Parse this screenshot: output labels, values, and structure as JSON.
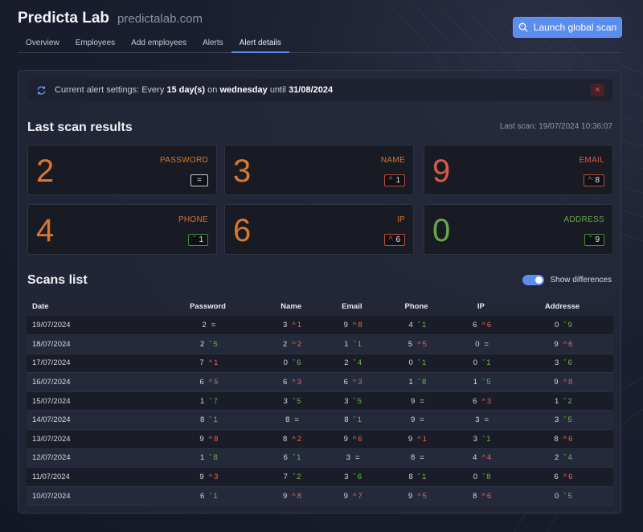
{
  "app": {
    "brand": "Predicta Lab",
    "domain": "predictalab.com"
  },
  "actions": {
    "launch_label": "Launch global scan"
  },
  "tabs": [
    "Overview",
    "Employees",
    "Add employees",
    "Alerts",
    "Alert details"
  ],
  "active_tab": "Alert details",
  "alert": {
    "prefix": "Current alert settings: Every ",
    "days": "15 day(s)",
    "mid1": " on ",
    "weekday": "wednesday",
    "mid2": " until ",
    "until": "31/08/2024",
    "close": "×"
  },
  "results": {
    "title": "Last scan results",
    "last_scan": "Last scan: 19/07/2024 10:36:07",
    "cards": [
      {
        "label": "PASSWORD",
        "value": "2",
        "color": "orange",
        "trend": "eq",
        "delta": "="
      },
      {
        "label": "NAME",
        "value": "3",
        "color": "orange",
        "trend": "up",
        "delta": "1"
      },
      {
        "label": "EMAIL",
        "value": "9",
        "color": "red",
        "trend": "up",
        "delta": "8"
      },
      {
        "label": "PHONE",
        "value": "4",
        "color": "orange",
        "trend": "down",
        "delta": "1"
      },
      {
        "label": "IP",
        "value": "6",
        "color": "orange",
        "trend": "up",
        "delta": "6"
      },
      {
        "label": "ADDRESS",
        "value": "0",
        "color": "green",
        "trend": "down",
        "delta": "9"
      }
    ],
    "colors": {
      "orange": "#d9772e",
      "red": "#d95a45",
      "green": "#6aa54a",
      "accent": "#5b8def"
    }
  },
  "scans": {
    "title": "Scans list",
    "toggle_label": "Show differences",
    "toggle_on": true,
    "columns": [
      "Date",
      "Password",
      "Name",
      "Email",
      "Phone",
      "IP",
      "Addresse"
    ],
    "rows": [
      [
        "19/07/2024",
        [
          "2",
          "eq",
          ""
        ],
        [
          "3",
          "up",
          "1"
        ],
        [
          "9",
          "up",
          "8"
        ],
        [
          "4",
          "down",
          "1"
        ],
        [
          "6",
          "up",
          "6"
        ],
        [
          "0",
          "down",
          "9"
        ]
      ],
      [
        "18/07/2024",
        [
          "2",
          "down",
          "5"
        ],
        [
          "2",
          "up",
          "2"
        ],
        [
          "1",
          "down",
          "1"
        ],
        [
          "5",
          "up",
          "5"
        ],
        [
          "0",
          "eq",
          ""
        ],
        [
          "9",
          "up",
          "6"
        ]
      ],
      [
        "17/07/2024",
        [
          "7",
          "up",
          "1"
        ],
        [
          "0",
          "down",
          "6"
        ],
        [
          "2",
          "down",
          "4"
        ],
        [
          "0",
          "down",
          "1"
        ],
        [
          "0",
          "down",
          "1"
        ],
        [
          "3",
          "down",
          "6"
        ]
      ],
      [
        "16/07/2024",
        [
          "6",
          "up",
          "5"
        ],
        [
          "6",
          "up",
          "3"
        ],
        [
          "6",
          "up",
          "3"
        ],
        [
          "1",
          "down",
          "8"
        ],
        [
          "1",
          "down",
          "5"
        ],
        [
          "9",
          "up",
          "8"
        ]
      ],
      [
        "15/07/2024",
        [
          "1",
          "down",
          "7"
        ],
        [
          "3",
          "down",
          "5"
        ],
        [
          "3",
          "down",
          "5"
        ],
        [
          "9",
          "eq",
          ""
        ],
        [
          "6",
          "up",
          "3"
        ],
        [
          "1",
          "down",
          "2"
        ]
      ],
      [
        "14/07/2024",
        [
          "8",
          "down",
          "1"
        ],
        [
          "8",
          "eq",
          ""
        ],
        [
          "8",
          "down",
          "1"
        ],
        [
          "9",
          "eq",
          ""
        ],
        [
          "3",
          "eq",
          ""
        ],
        [
          "3",
          "down",
          "5"
        ]
      ],
      [
        "13/07/2024",
        [
          "9",
          "up",
          "8"
        ],
        [
          "8",
          "up",
          "2"
        ],
        [
          "9",
          "up",
          "6"
        ],
        [
          "9",
          "up",
          "1"
        ],
        [
          "3",
          "down",
          "1"
        ],
        [
          "8",
          "up",
          "6"
        ]
      ],
      [
        "12/07/2024",
        [
          "1",
          "down",
          "8"
        ],
        [
          "6",
          "down",
          "1"
        ],
        [
          "3",
          "eq",
          ""
        ],
        [
          "8",
          "eq",
          ""
        ],
        [
          "4",
          "up",
          "4"
        ],
        [
          "2",
          "down",
          "4"
        ]
      ],
      [
        "11/07/2024",
        [
          "9",
          "up",
          "3"
        ],
        [
          "7",
          "down",
          "2"
        ],
        [
          "3",
          "down",
          "6"
        ],
        [
          "8",
          "down",
          "1"
        ],
        [
          "0",
          "down",
          "8"
        ],
        [
          "6",
          "up",
          "6"
        ]
      ],
      [
        "10/07/2024",
        [
          "6",
          "down",
          "1"
        ],
        [
          "9",
          "up",
          "8"
        ],
        [
          "9",
          "up",
          "7"
        ],
        [
          "9",
          "up",
          "5"
        ],
        [
          "8",
          "up",
          "6"
        ],
        [
          "0",
          "down",
          "5"
        ]
      ]
    ]
  }
}
